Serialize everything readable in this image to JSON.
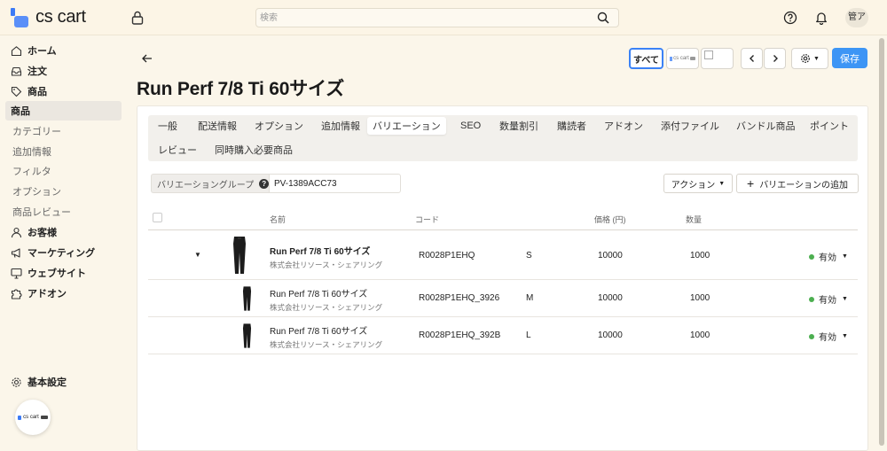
{
  "header": {
    "logo_text": "cs cart",
    "search_placeholder": "検索",
    "avatar_text": "管ア"
  },
  "sidebar": {
    "items": [
      {
        "label": "ホーム",
        "icon": "home-icon"
      },
      {
        "label": "注文",
        "icon": "inbox-icon"
      },
      {
        "label": "商品",
        "icon": "tag-icon"
      },
      {
        "label": "商品"
      },
      {
        "label": "カテゴリー"
      },
      {
        "label": "追加情報"
      },
      {
        "label": "フィルタ"
      },
      {
        "label": "オプション"
      },
      {
        "label": "商品レビュー"
      },
      {
        "label": "お客様",
        "icon": "user-icon"
      },
      {
        "label": "マーケティング",
        "icon": "megaphone-icon"
      },
      {
        "label": "ウェブサイト",
        "icon": "monitor-icon"
      },
      {
        "label": "アドオン",
        "icon": "puzzle-icon"
      }
    ],
    "settings_label": "基本設定",
    "float_logo_text": "cs cart"
  },
  "toolbar": {
    "all_label": "すべて",
    "store_logo_text": "cs cart",
    "save_label": "保存"
  },
  "page": {
    "title": "Run Perf 7/8 Ti 60サイズ"
  },
  "tabs": [
    "一般",
    "配送情報",
    "オプション",
    "追加情報",
    "バリエーション",
    "SEO",
    "数量割引",
    "購読者",
    "アドオン",
    "添付ファイル",
    "バンドル商品",
    "ポイント",
    "レビュー",
    "同時購入必要商品"
  ],
  "active_tab": "バリエーション",
  "variations": {
    "group_label": "バリエーショングループ",
    "group_code": "PV-1389ACC73",
    "action_label": "アクション",
    "add_label": "バリエーションの追加",
    "columns": {
      "name": "名前",
      "code": "コード",
      "price": "価格 (円)",
      "quantity": "数量"
    },
    "rows": [
      {
        "name": "Run Perf 7/8 Ti 60サイズ",
        "vendor": "株式会社リソース・シェアリング",
        "code": "R0028P1EHQ",
        "size": "S",
        "price": "10000",
        "quantity": "1000",
        "status": "有効"
      },
      {
        "name": "Run Perf 7/8 Ti 60サイズ",
        "vendor": "株式会社リソース・シェアリング",
        "code": "R0028P1EHQ_3926",
        "size": "M",
        "price": "10000",
        "quantity": "1000",
        "status": "有効"
      },
      {
        "name": "Run Perf 7/8 Ti 60サイズ",
        "vendor": "株式会社リソース・シェアリング",
        "code": "R0028P1EHQ_392B",
        "size": "L",
        "price": "10000",
        "quantity": "1000",
        "status": "有効"
      }
    ]
  },
  "colors": {
    "accent": "#3d95f5",
    "status_active": "#4caf50",
    "background": "#fbf6ea"
  }
}
